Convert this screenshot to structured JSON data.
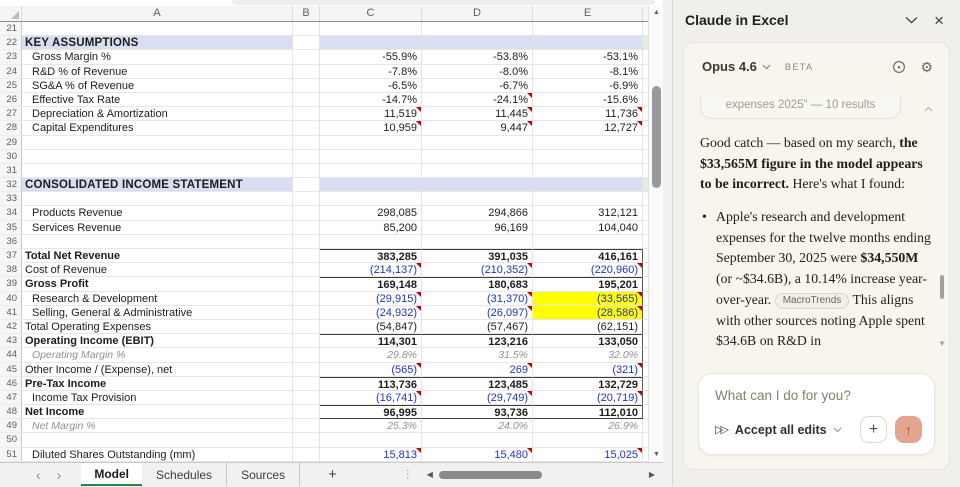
{
  "colors": {
    "section_band": "#dadef2",
    "highlight_yellow": "#ffff00",
    "input_font_blue": "#2233c4",
    "note_marker_red": "#c00000",
    "active_tab_green": "#1d8a4e",
    "send_button_salmon": "#e3a58f",
    "panel_card_cream": "#f7f5ee"
  },
  "icons": {
    "nav_prev": "‹",
    "nav_next": "›",
    "scroll_up": "▲",
    "scroll_down": "▼",
    "scroll_left": "◀",
    "scroll_right": "▶",
    "dots": "⋮",
    "add_sheet": "+",
    "gear": "⚙",
    "close": "×",
    "bullet": "•",
    "plus": "+",
    "send_arrow": "↑",
    "fast_forward": "▷▷",
    "chat_scroll_down": "▼"
  },
  "sheet": {
    "col_headers": [
      "A",
      "B",
      "C",
      "D",
      "E"
    ],
    "rows": [
      {
        "n": 21
      },
      {
        "n": 22,
        "label": "KEY ASSUMPTIONS",
        "lb": true,
        "band": true
      },
      {
        "n": 23,
        "label": "Gross Margin %",
        "ind": true,
        "vals": [
          "-55.9%",
          "-53.8%",
          "-53.1%"
        ]
      },
      {
        "n": 24,
        "label": "R&D % of Revenue",
        "ind": true,
        "vals": [
          "-7.8%",
          "-8.0%",
          "-8.1%"
        ]
      },
      {
        "n": 25,
        "label": "SG&A % of Revenue",
        "ind": true,
        "vals": [
          "-6.5%",
          "-6.7%",
          "-6.9%"
        ]
      },
      {
        "n": 26,
        "label": "Effective Tax Rate",
        "ind": true,
        "vals": [
          "-14.7%",
          "-24.1%",
          "-15.6%"
        ],
        "m": [
          false,
          true,
          false
        ]
      },
      {
        "n": 27,
        "label": "Depreciation & Amortization",
        "ind": true,
        "vals": [
          "11,519",
          "11,445",
          "11,736"
        ],
        "m": [
          true,
          true,
          true
        ]
      },
      {
        "n": 28,
        "label": "Capital Expenditures",
        "ind": true,
        "vals": [
          "10,959",
          "9,447",
          "12,727"
        ],
        "m": [
          true,
          true,
          true
        ]
      },
      {
        "n": 29
      },
      {
        "n": 30
      },
      {
        "n": 31
      },
      {
        "n": 32,
        "label": "CONSOLIDATED INCOME STATEMENT",
        "lb": true,
        "band": true
      },
      {
        "n": 33
      },
      {
        "n": 34,
        "label": "Products Revenue",
        "ind": true,
        "vals": [
          "298,085",
          "294,866",
          "312,121"
        ]
      },
      {
        "n": 35,
        "label": "Services Revenue",
        "ind": true,
        "vals": [
          "85,200",
          "96,169",
          "104,040"
        ]
      },
      {
        "n": 36
      },
      {
        "n": 37,
        "label": "Total Net Revenue",
        "lb": true,
        "vb": true,
        "bt": true,
        "re": true,
        "vals": [
          "383,285",
          "391,035",
          "416,161"
        ]
      },
      {
        "n": 38,
        "label": "Cost of Revenue",
        "blue": true,
        "re": true,
        "vals": [
          "(214,137)",
          "(210,352)",
          "(220,960)"
        ],
        "m": [
          true,
          true,
          true
        ]
      },
      {
        "n": 39,
        "label": "Gross Profit",
        "lb": true,
        "vb": true,
        "bt": true,
        "re": true,
        "vals": [
          "169,148",
          "180,683",
          "195,201"
        ]
      },
      {
        "n": 40,
        "label": "Research & Development",
        "ind": true,
        "blue": true,
        "re": true,
        "hlE": true,
        "vals": [
          "(29,915)",
          "(31,370)",
          "(33,565)"
        ],
        "m": [
          true,
          true,
          true
        ]
      },
      {
        "n": 41,
        "label": "Selling, General & Administrative",
        "ind": true,
        "blue": true,
        "re": true,
        "hlE": true,
        "vals": [
          "(24,932)",
          "(26,097)",
          "(28,586)"
        ],
        "m": [
          true,
          true,
          true
        ]
      },
      {
        "n": 42,
        "label": "Total Operating Expenses",
        "re": true,
        "vals": [
          "(54,847)",
          "(57,467)",
          "(62,151)"
        ]
      },
      {
        "n": 43,
        "label": "Operating Income (EBIT)",
        "lb": true,
        "vb": true,
        "bt": true,
        "re": true,
        "vals": [
          "114,301",
          "123,216",
          "133,050"
        ]
      },
      {
        "n": 44,
        "label": "Operating Margin %",
        "ind": true,
        "li": true,
        "vi": true,
        "re": true,
        "vals": [
          "29.8%",
          "31.5%",
          "32.0%"
        ]
      },
      {
        "n": 45,
        "label": "Other Income / (Expense), net",
        "blue": true,
        "re": true,
        "vals": [
          "(565)",
          "269",
          "(321)"
        ],
        "m": [
          true,
          true,
          true
        ]
      },
      {
        "n": 46,
        "label": "Pre-Tax Income",
        "lb": true,
        "vb": true,
        "bt": true,
        "re": true,
        "vals": [
          "113,736",
          "123,485",
          "132,729"
        ]
      },
      {
        "n": 47,
        "label": "Income Tax Provision",
        "ind": true,
        "blue": true,
        "re": true,
        "vals": [
          "(16,741)",
          "(29,749)",
          "(20,719)"
        ],
        "m": [
          true,
          true,
          true
        ]
      },
      {
        "n": 48,
        "label": "Net Income",
        "lb": true,
        "vb": true,
        "bt": true,
        "bb": true,
        "re": true,
        "vals": [
          "96,995",
          "93,736",
          "112,010"
        ]
      },
      {
        "n": 49,
        "label": "Net Margin %",
        "ind": true,
        "li": true,
        "vi": true,
        "vals": [
          "25.3%",
          "24.0%",
          "26.9%"
        ]
      },
      {
        "n": 50
      },
      {
        "n": 51,
        "label": "Diluted Shares Outstanding (mm)",
        "ind": true,
        "blue": true,
        "vals": [
          "15,813",
          "15,480",
          "15,025"
        ],
        "m": [
          true,
          true,
          true
        ]
      }
    ]
  },
  "tabs": {
    "items": [
      "Model",
      "Schedules",
      "Sources"
    ],
    "active": "Model",
    "add_label": "+"
  },
  "panel": {
    "title": "Claude in Excel",
    "model_name": "Opus 4.6",
    "beta_badge": "BETA",
    "tool_result": "expenses 2025\" — 10 results",
    "message": {
      "pre": "Good catch — based on my search, ",
      "bold": "the $33,565M figure in the model appears to be incorrect.",
      "post": " Here's what I found:"
    },
    "bullet": {
      "pre": "Apple's research and development expenses for the twelve months ending September 30, 2025 were ",
      "bold": "$34,550M",
      "mid": " (or ~$34.6B), a 10.14% increase year-over-year. ",
      "chip": "MacroTrends",
      "post": " This aligns with other sources noting Apple spent $34.6B on R&D in"
    },
    "input_placeholder": "What can I do for you?",
    "accept_label": "Accept all edits"
  }
}
